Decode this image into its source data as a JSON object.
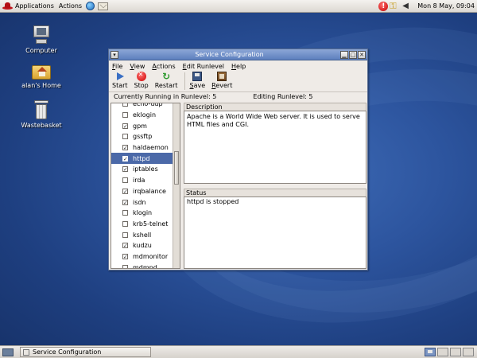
{
  "top_panel": {
    "applications": "Applications",
    "actions": "Actions",
    "clock": "Mon  8 May, 09:04"
  },
  "desktop_icons": [
    {
      "label": "Computer",
      "icon": "computer-icon"
    },
    {
      "label": "alan's Home",
      "icon": "home-folder-icon"
    },
    {
      "label": "Wastebasket",
      "icon": "trash-icon"
    }
  ],
  "window": {
    "title": "Service Configuration",
    "menu": [
      "File",
      "View",
      "Actions",
      "Edit Runlevel",
      "Help"
    ],
    "toolbar": {
      "start": "Start",
      "stop": "Stop",
      "restart": "Restart",
      "save": "Save",
      "revert": "Revert"
    },
    "runlevel": {
      "current": "Currently Running in Runlevel: 5",
      "editing": "Editing Runlevel: 5"
    },
    "services": [
      {
        "name": "echo-udp",
        "checked": false
      },
      {
        "name": "eklogin",
        "checked": false
      },
      {
        "name": "gpm",
        "checked": true
      },
      {
        "name": "gssftp",
        "checked": false
      },
      {
        "name": "haldaemon",
        "checked": true
      },
      {
        "name": "httpd",
        "checked": true,
        "selected": true
      },
      {
        "name": "iptables",
        "checked": true
      },
      {
        "name": "irda",
        "checked": false
      },
      {
        "name": "irqbalance",
        "checked": true
      },
      {
        "name": "isdn",
        "checked": true
      },
      {
        "name": "klogin",
        "checked": false
      },
      {
        "name": "krb5-telnet",
        "checked": false
      },
      {
        "name": "kshell",
        "checked": false
      },
      {
        "name": "kudzu",
        "checked": true
      },
      {
        "name": "mdmonitor",
        "checked": true
      },
      {
        "name": "mdmpd",
        "checked": false
      }
    ],
    "description_label": "Description",
    "description_text": "Apache is a World Wide Web server.  It is used to serve HTML files and CGI.",
    "status_label": "Status",
    "status_text": "httpd is stopped"
  },
  "bottom_panel": {
    "task": "Service Configuration"
  }
}
